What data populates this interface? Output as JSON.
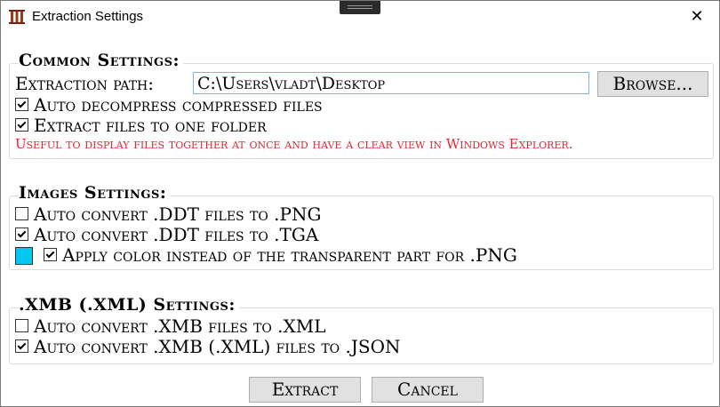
{
  "window": {
    "title": "Extraction Settings",
    "close_glyph": "✕"
  },
  "common": {
    "title": "Common Settings:",
    "path_label": "Extraction path:",
    "path_value": "C:\\Users\\vladt\\Desktop",
    "browse_label": "Browse...",
    "auto_decompress_label": "Auto decompress compressed files",
    "auto_decompress_checked": true,
    "extract_one_folder_label": "Extract files to one folder",
    "extract_one_folder_checked": true,
    "hint": "Useful to display files together at once and have a clear view in Windows Explorer."
  },
  "images": {
    "title": "Images Settings:",
    "ddt_png_label": "Auto convert .DDT files to .PNG",
    "ddt_png_checked": false,
    "ddt_tga_label": "Auto convert .DDT files to .TGA",
    "ddt_tga_checked": true,
    "apply_color_label": "Apply color instead of the transparent part for .PNG",
    "apply_color_checked": true,
    "color_value": "#00c8f0"
  },
  "xmb": {
    "title": ".XMB (.XML) Settings:",
    "xmb_xml_label": "Auto convert .XMB files to .XML",
    "xmb_xml_checked": false,
    "xmb_json_label": "Auto convert .XMB (.XML) files to .JSON",
    "xmb_json_checked": true
  },
  "footer": {
    "extract_label": "Extract",
    "cancel_label": "Cancel"
  },
  "colors": {
    "hint": "#e3262d",
    "input_border": "#7eb4ea",
    "button_bg": "#e1e1e1"
  }
}
